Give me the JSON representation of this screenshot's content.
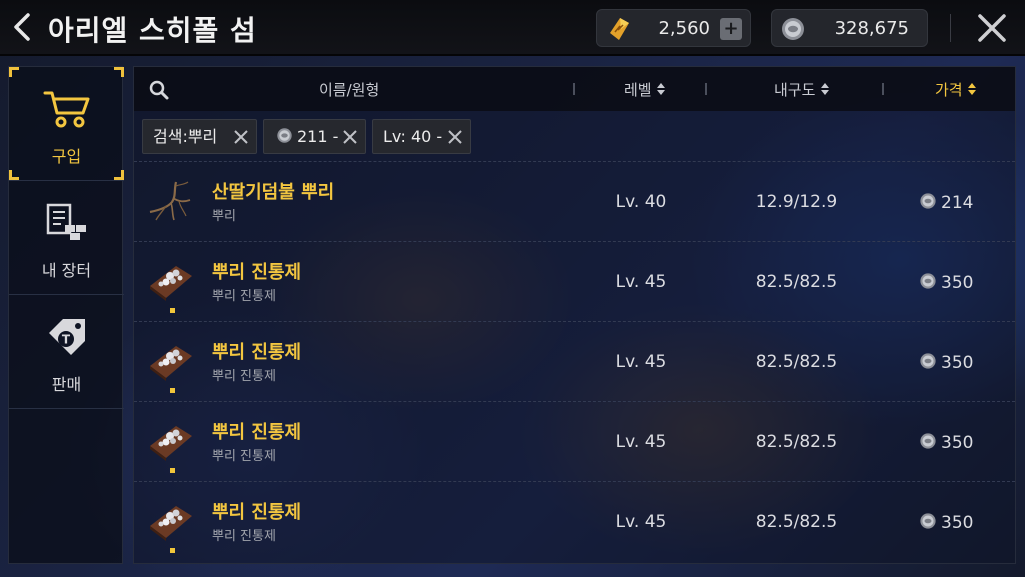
{
  "header": {
    "title": "아리엘 스히폴 섬",
    "gold_amount": "2,560",
    "silver_amount": "328,675"
  },
  "sidebar": {
    "items": [
      {
        "label": "구입",
        "icon": "cart-icon",
        "active": true
      },
      {
        "label": "내 장터",
        "icon": "my-market-icon",
        "active": false
      },
      {
        "label": "판매",
        "icon": "sell-tag-icon",
        "active": false
      }
    ]
  },
  "table": {
    "columns": {
      "name": "이름/원형",
      "level": "레벨",
      "durability": "내구도",
      "price": "가격"
    },
    "active_sort": "price",
    "filters": [
      {
        "label": "검색:뿌리"
      },
      {
        "label": "211 -"
      },
      {
        "label": "Lv: 40 -"
      }
    ],
    "rows": [
      {
        "name": "산딸기덤불 뿌리",
        "type": "뿌리",
        "level": "Lv. 40",
        "durability": "12.9/12.9",
        "price": "214",
        "icon": "root-icon"
      },
      {
        "name": "뿌리 진통제",
        "type": "뿌리 진통제",
        "level": "Lv. 45",
        "durability": "82.5/82.5",
        "price": "350",
        "icon": "painkiller-icon"
      },
      {
        "name": "뿌리 진통제",
        "type": "뿌리 진통제",
        "level": "Lv. 45",
        "durability": "82.5/82.5",
        "price": "350",
        "icon": "painkiller-icon"
      },
      {
        "name": "뿌리 진통제",
        "type": "뿌리 진통제",
        "level": "Lv. 45",
        "durability": "82.5/82.5",
        "price": "350",
        "icon": "painkiller-icon"
      },
      {
        "name": "뿌리 진통제",
        "type": "뿌리 진통제",
        "level": "Lv. 45",
        "durability": "82.5/82.5",
        "price": "350",
        "icon": "painkiller-icon"
      }
    ]
  },
  "colors": {
    "accent": "#f3c640",
    "background": "#1a2342",
    "text": "#dcdde2"
  }
}
